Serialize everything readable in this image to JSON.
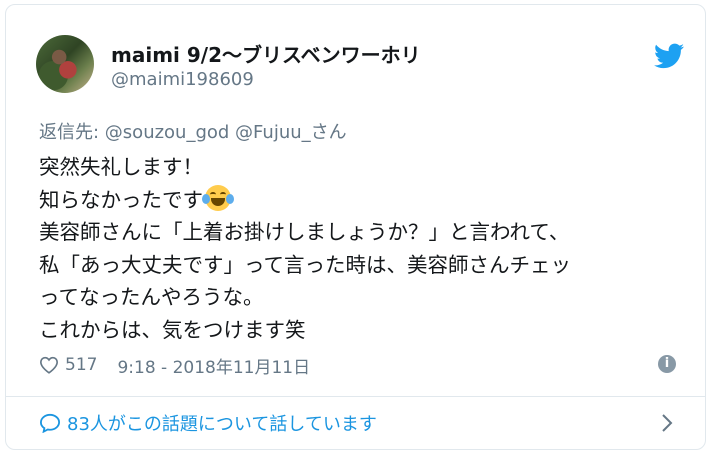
{
  "user": {
    "display_name": "maimi 9/2〜ブリスベンワーホリ",
    "handle": "@maimi198609"
  },
  "tweet": {
    "reply_prefix": "返信先: ",
    "reply_mentions": "@souzou_god @Fujuu_",
    "reply_suffix": "さん",
    "lines": [
      "突然失礼します！",
      "知らなかったです",
      "美容師さんに「上着お掛けしましょうか？」と言われて、",
      "私「あっ大丈夫です」って言った時は、美容師さんチェッ",
      "ってなったんやろうな。",
      "これからは、気をつけます笑"
    ],
    "emoji": "face-with-tears-of-joy-icon"
  },
  "meta": {
    "likes": "517",
    "timestamp": "9:18 - 2018年11月11日"
  },
  "footer": {
    "conversation_text": "83人がこの話題について話しています"
  },
  "colors": {
    "brand": "#1da1f2",
    "link": "#1b95e0",
    "muted": "#657786",
    "text": "#14171a"
  }
}
